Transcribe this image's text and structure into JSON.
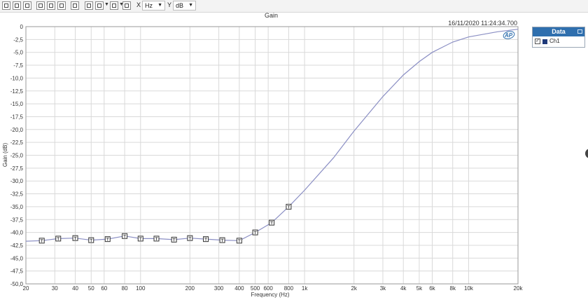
{
  "toolbar": {
    "x_axis_label": "X",
    "x_unit": "Hz",
    "y_axis_label": "Y",
    "y_unit": "dB"
  },
  "timestamp": "16/11/2020 11:24:34.700",
  "logo_text": "AP",
  "legend": {
    "title": "Data",
    "items": [
      {
        "label": "Ch1",
        "checked": true,
        "color": "#1f3a7a"
      }
    ]
  },
  "colors": {
    "series_line": "#8b8fc4",
    "grid": "#d9d9d9",
    "axis": "#9a9a9a",
    "accent": "#2f6fae"
  },
  "chart_data": {
    "type": "line",
    "title": "Gain",
    "xlabel": "Frequency (Hz)",
    "ylabel": "Gain (dB)",
    "x_scale": "log",
    "xlim": [
      20,
      20000
    ],
    "ylim": [
      -50,
      0
    ],
    "grid": true,
    "legend_position": "right",
    "x_ticks": [
      20,
      30,
      40,
      50,
      60,
      80,
      100,
      200,
      300,
      400,
      500,
      600,
      800,
      1000,
      2000,
      3000,
      4000,
      5000,
      6000,
      8000,
      10000,
      20000
    ],
    "x_tick_labels": [
      "20",
      "30",
      "40",
      "50",
      "60",
      "80",
      "100",
      "200",
      "300",
      "400",
      "500",
      "600",
      "800",
      "1k",
      "2k",
      "3k",
      "4k",
      "5k",
      "6k",
      "8k",
      "10k",
      "20k"
    ],
    "y_ticks": [
      0,
      -2.5,
      -5,
      -7.5,
      -10,
      -12.5,
      -15,
      -17.5,
      -20,
      -22.5,
      -25,
      -27.5,
      -30,
      -32.5,
      -35,
      -37.5,
      -40,
      -42.5,
      -45,
      -47.5,
      -50
    ],
    "y_tick_labels": [
      "0",
      "-2,5",
      "-5,0",
      "-7,5",
      "-10,0",
      "-12,5",
      "-15,0",
      "-17,5",
      "-20,0",
      "-22,5",
      "-25,0",
      "-27,5",
      "-30,0",
      "-32,5",
      "-35,0",
      "-37,5",
      "-40,0",
      "-42,5",
      "-45,0",
      "-47,5",
      "-50,0"
    ],
    "series": [
      {
        "name": "Ch1",
        "points": [
          [
            20,
            -41.7
          ],
          [
            25,
            -41.6
          ],
          [
            31.5,
            -41.2
          ],
          [
            40,
            -41.1
          ],
          [
            50,
            -41.5
          ],
          [
            63,
            -41.3
          ],
          [
            80,
            -40.7
          ],
          [
            100,
            -41.2
          ],
          [
            125,
            -41.2
          ],
          [
            160,
            -41.4
          ],
          [
            200,
            -41.1
          ],
          [
            250,
            -41.3
          ],
          [
            315,
            -41.5
          ],
          [
            400,
            -41.6
          ],
          [
            500,
            -40.0
          ],
          [
            630,
            -38.1
          ],
          [
            800,
            -35.0
          ],
          [
            1000,
            -31.8
          ],
          [
            1500,
            -25.5
          ],
          [
            2000,
            -20.3
          ],
          [
            3000,
            -13.6
          ],
          [
            4000,
            -9.4
          ],
          [
            5000,
            -6.8
          ],
          [
            6000,
            -5.0
          ],
          [
            8000,
            -3.0
          ],
          [
            10000,
            -2.0
          ],
          [
            15000,
            -1.0
          ],
          [
            20000,
            -0.5
          ]
        ],
        "marker_x": [
          25,
          31.5,
          40,
          50,
          63,
          80,
          100,
          125,
          160,
          200,
          250,
          315,
          400,
          500,
          630,
          800
        ]
      }
    ]
  }
}
